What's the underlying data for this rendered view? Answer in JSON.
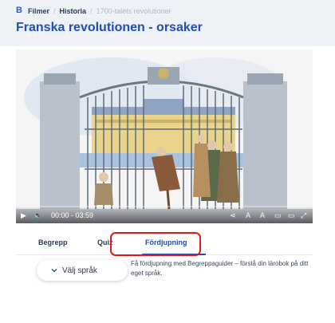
{
  "breadcrumb": {
    "items": [
      "Filmer",
      "Historia",
      "1700-talets revolutioner"
    ]
  },
  "page": {
    "title": "Franska revolutionen - orsaker"
  },
  "player": {
    "time": "00:00 - 03:59"
  },
  "tabs": [
    "Begrepp",
    "Quiz",
    "Fördjupning"
  ],
  "language": {
    "label": "Välj språk"
  },
  "content": {
    "text": "Få fördjupning med Begreppaguider – förstå din lärobok på ditt eget språk."
  },
  "colors": {
    "accent": "#1f4fb0",
    "highlight": "#e01a1a",
    "header_bg": "#eef1f6"
  }
}
